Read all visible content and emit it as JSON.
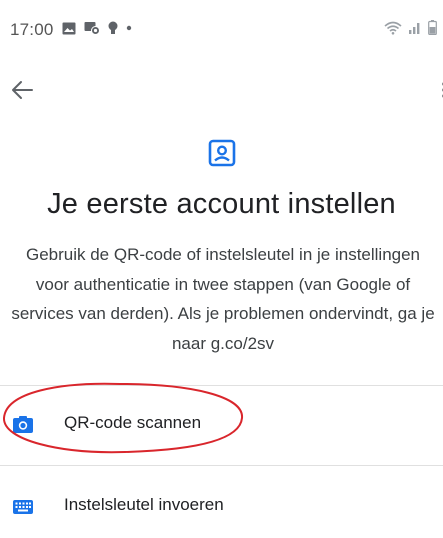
{
  "status_bar": {
    "time": "17:00",
    "left_icons": [
      "gallery-icon",
      "screen-record-icon",
      "bulb-icon",
      "dot-icon"
    ],
    "right_icons": [
      "wifi-icon",
      "signal-icon",
      "battery-icon"
    ]
  },
  "app_bar": {
    "back_icon": "arrow-back-icon",
    "more_icon": "more-vert-icon"
  },
  "header": {
    "icon": "account-box-icon",
    "title": "Je eerste account instellen",
    "description": "Gebruik de QR-code of instelsleutel in je instellingen voor authenticatie in twee stappen (van Google of services van derden). Als je problemen ondervindt, ga je naar g.co/2sv"
  },
  "options": [
    {
      "icon": "camera-icon",
      "label": "QR-code scannen",
      "highlighted": true
    },
    {
      "icon": "keyboard-icon",
      "label": "Instelsleutel invoeren",
      "highlighted": false
    }
  ],
  "colors": {
    "accent": "#1a73e8",
    "highlight": "#d9262c",
    "divider": "#e0e0e0",
    "text": "#202124"
  }
}
